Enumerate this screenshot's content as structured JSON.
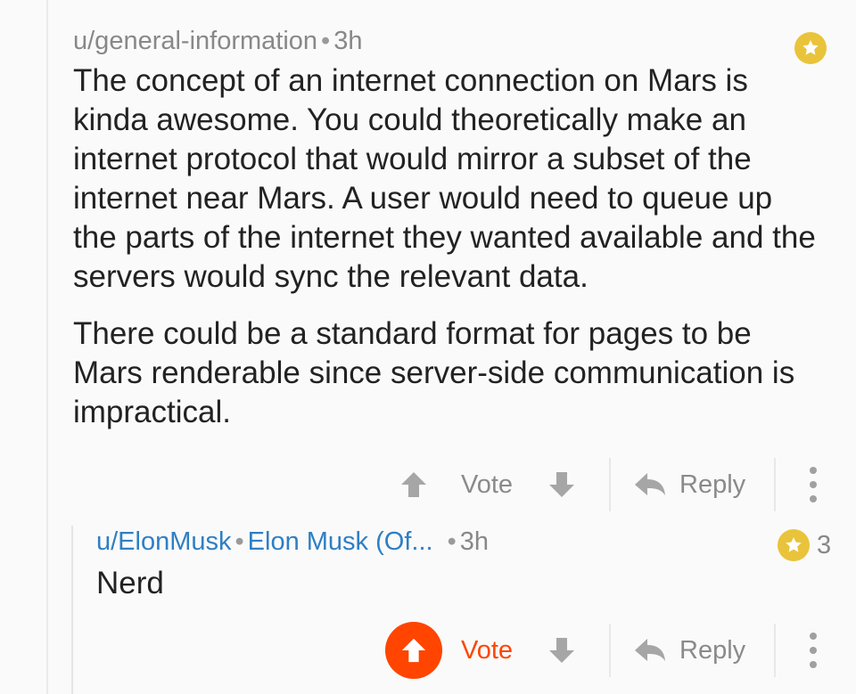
{
  "comment1": {
    "username": "u/general-information",
    "age": "3h",
    "paragraphs": [
      "The concept of an internet connection on Mars is kinda awesome. You could theoretically make an internet protocol that would mirror a subset of the internet near Mars. A user would need to queue up the parts of the internet they wanted available and the servers would sync the relevant data.",
      "There could be a standard format for pages to be Mars renderable since server-side communication is impractical."
    ],
    "vote_label": "Vote",
    "reply_label": "Reply"
  },
  "comment2": {
    "username": "u/ElonMusk",
    "flair": "Elon Musk (Of...",
    "age": "3h",
    "award_count": "3",
    "text": "Nerd",
    "vote_label": "Vote",
    "reply_label": "Reply",
    "upvoted": true
  },
  "colors": {
    "upvote_active": "#ff4500",
    "award_gold": "#e9c33a",
    "username_blue": "#2e7fc4"
  },
  "icons": [
    "award-star-icon",
    "upvote-arrow-icon",
    "downvote-arrow-icon",
    "reply-arrow-icon",
    "more-options-icon"
  ]
}
